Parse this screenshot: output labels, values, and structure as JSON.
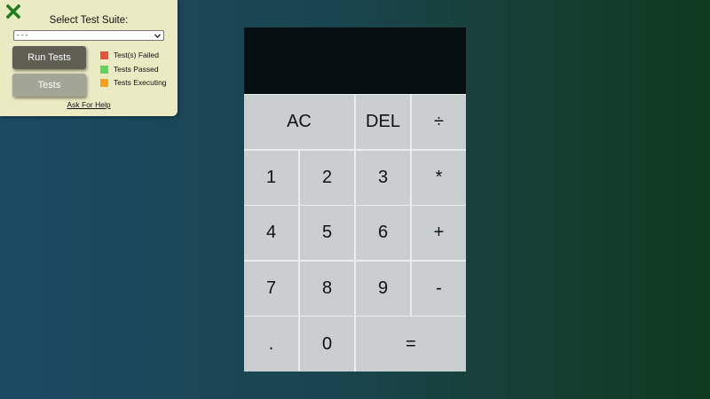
{
  "test_panel": {
    "title": "Select Test Suite:",
    "suite_select_value": "- - -",
    "run_button": "Run Tests",
    "tests_button": "Tests",
    "legend": [
      {
        "label": "Test(s) Failed",
        "color": "#e8513b"
      },
      {
        "label": "Tests Passed",
        "color": "#5fd35b"
      },
      {
        "label": "Tests Executing",
        "color": "#f5a01a"
      }
    ],
    "help_link": "Ask For Help",
    "close_icon_color": "#1f7d1f"
  },
  "calculator": {
    "display_value": "",
    "keys": {
      "clear": "AC",
      "delete": "DEL",
      "divide": "÷",
      "one": "1",
      "two": "2",
      "three": "3",
      "multiply": "*",
      "four": "4",
      "five": "5",
      "six": "6",
      "add": "+",
      "seven": "7",
      "eight": "8",
      "nine": "9",
      "subtract": "-",
      "decimal": ".",
      "zero": "0",
      "equals": "="
    }
  }
}
